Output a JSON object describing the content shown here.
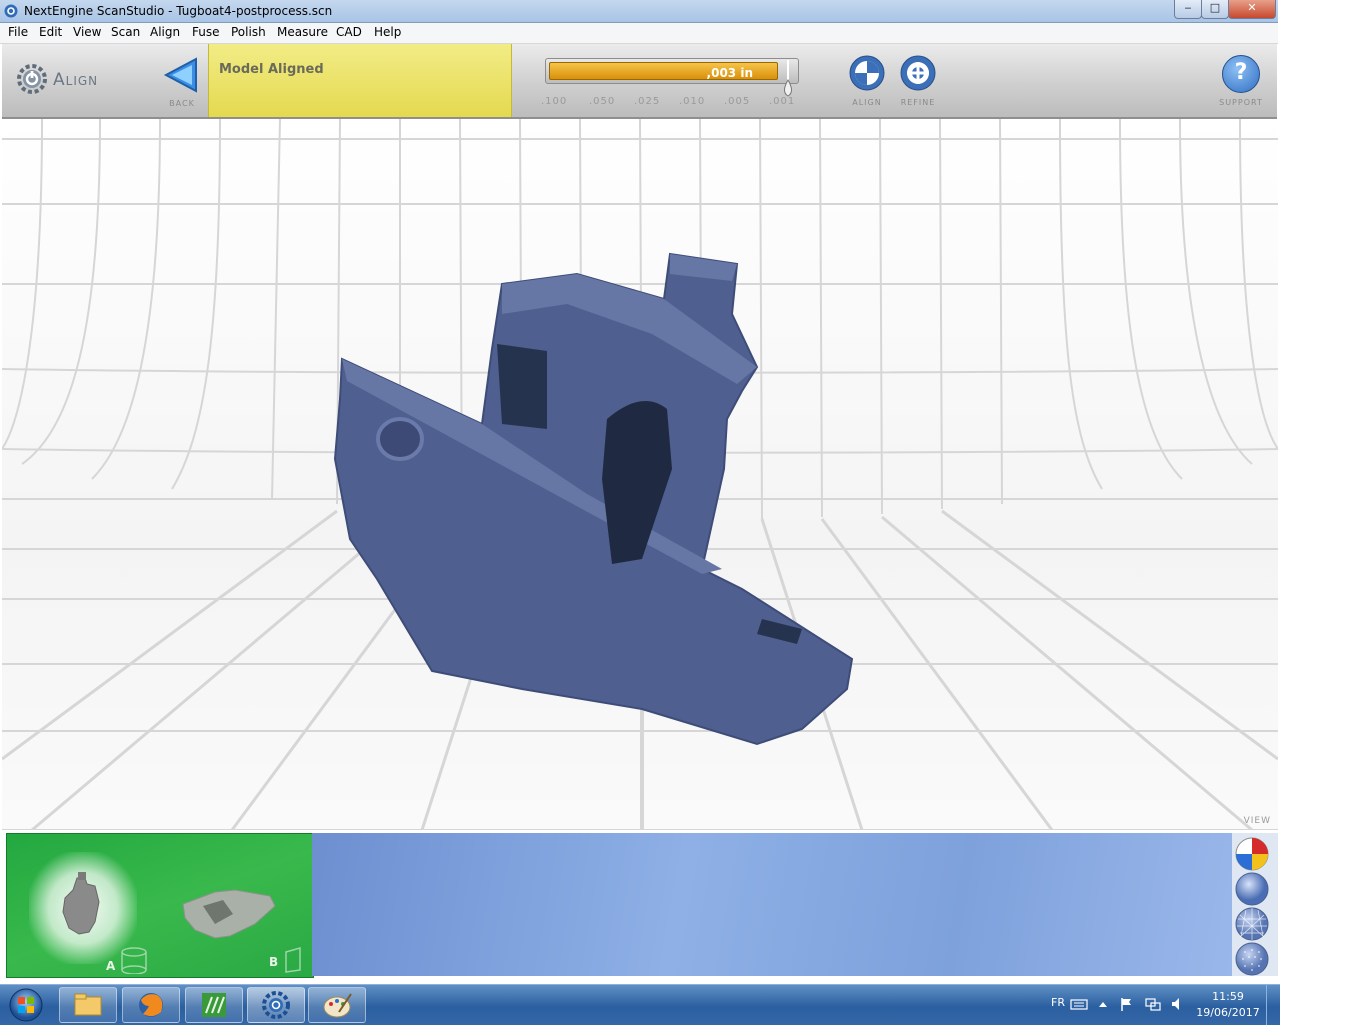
{
  "window": {
    "title": "NextEngine ScanStudio - Tugboat4-postprocess.scn",
    "controls": {
      "minimize": "‒",
      "maximize": "□",
      "close": "✕"
    }
  },
  "menu": {
    "items": [
      "File",
      "Edit",
      "View",
      "Scan",
      "Align",
      "Fuse",
      "Polish",
      "Measure",
      "CAD",
      "Help"
    ]
  },
  "toolbar": {
    "mode_label": "Align",
    "back_label": "Back",
    "status": "Model Aligned",
    "slider": {
      "value_label": ",003 in",
      "fill_fraction": 0.93,
      "ticks": [
        ".100",
        ".050",
        ".025",
        ".010",
        ".005",
        ".001"
      ]
    },
    "align_label": "Align",
    "refine_label": "Refine",
    "support_label": "Support",
    "support_glyph": "?"
  },
  "viewport": {
    "view_label": "View",
    "model_color": "#4f5f8f"
  },
  "scans": {
    "a_label": "A",
    "b_label": "B"
  },
  "taskbar": {
    "language": "FR",
    "time": "11:59",
    "date": "19/06/2017",
    "apps": [
      "file-explorer-icon",
      "firefox-icon",
      "app-icon",
      "scanstudio-icon",
      "paint-icon"
    ]
  },
  "colors": {
    "status_yellow": "#e8dc55",
    "slider_orange": "#e9a21f",
    "scan_green": "#2aa844",
    "taskbar_blue": "#2a5fa0"
  }
}
